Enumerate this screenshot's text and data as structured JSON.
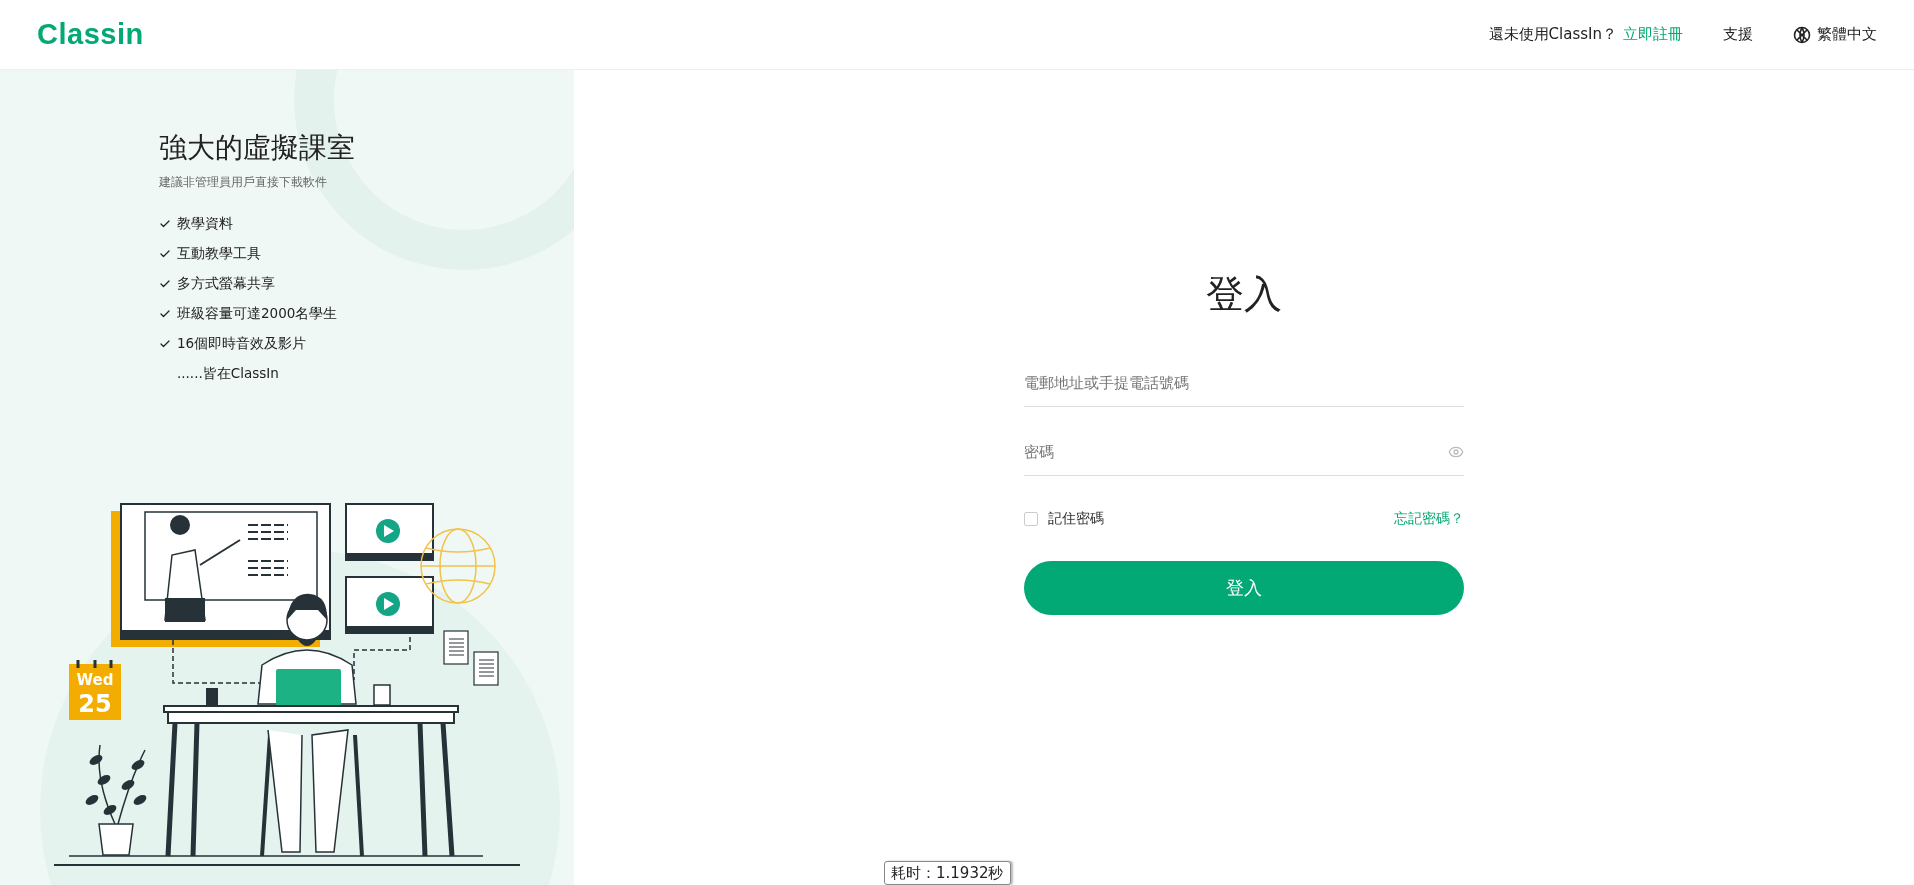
{
  "header": {
    "logo": "Classin",
    "prompt": "還未使用ClassIn？",
    "register_link": "立即註冊",
    "support_link": "支援",
    "language": "繁體中文"
  },
  "promo": {
    "title": "強大的虛擬課室",
    "subtitle": "建議非管理員用戶直接下載軟件",
    "features": [
      {
        "text": "教學資料",
        "checked": true
      },
      {
        "text": "互動教學工具",
        "checked": true
      },
      {
        "text": "多方式螢幕共享",
        "checked": true
      },
      {
        "text": "班級容量可達2000名學生",
        "checked": true
      },
      {
        "text": "16個即時音效及影片",
        "checked": true
      },
      {
        "text": "......皆在ClassIn",
        "checked": false
      }
    ],
    "calendar": {
      "day": "Wed",
      "date": "25"
    }
  },
  "login": {
    "title": "登入",
    "account_field": {
      "placeholder": "電郵地址或手提電話號碼"
    },
    "password_field": {
      "placeholder": "密碼"
    },
    "remember": {
      "label": "記住密碼",
      "checked": false
    },
    "forgot_link": "忘記密碼？",
    "submit": "登入"
  },
  "timing_tag": "耗时：1.1932秒"
}
